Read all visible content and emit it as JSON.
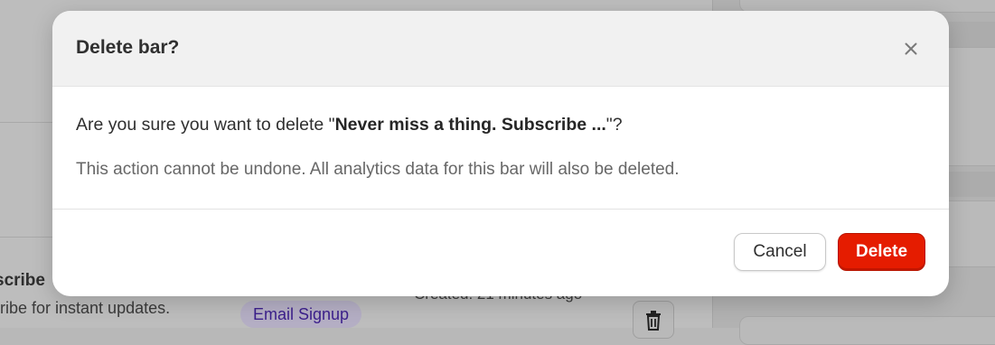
{
  "background": {
    "row_title": "scribe",
    "row_description": "ribe for instant updates.",
    "badge": "Email Signup",
    "created": "Created: 21 minutes ago"
  },
  "modal": {
    "title": "Delete bar?",
    "close_icon": "close-icon",
    "confirm_prefix": "Are you sure you want to delete \"",
    "bar_name": "Never miss a thing. Subscribe ...",
    "confirm_suffix": "\"?",
    "warning": "This action cannot be undone. All analytics data for this bar will also be deleted.",
    "cancel_label": "Cancel",
    "delete_label": "Delete"
  },
  "colors": {
    "danger": "#e51c00",
    "overlay": "#b9b9b9",
    "badge_text": "#3b1f8c"
  }
}
